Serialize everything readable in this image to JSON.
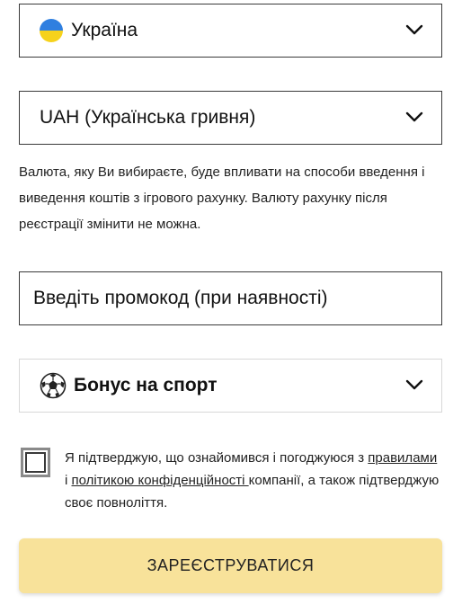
{
  "country": {
    "value": "Україна",
    "icon": "ukraine-flag-icon"
  },
  "currency": {
    "value": "UAH (Українська гривня)"
  },
  "currency_note": "Валюта, яку Ви вибираєте, буде впливати на способи введення і виведення коштів з ігрового рахунку. Валюту рахунку після реєстрації змінити не можна.",
  "promo": {
    "placeholder": "Введіть промокод (при наявності)"
  },
  "bonus": {
    "value": "Бонус на спорт",
    "icon": "soccer-ball-icon"
  },
  "agreement": {
    "text_before": "Я підтверджую, що ознайомився і погоджуюся з ",
    "rules_link": "правилами",
    "text_and": " і ",
    "privacy_link": "політикою конфіденційності ",
    "text_after": "компанії, а також підтверджую своє повноліття."
  },
  "submit_label": "ЗАРЕЄСТРУВАТИСЯ",
  "colors": {
    "submit_bg": "#f8e29a",
    "flag_blue": "#2f7fe0",
    "flag_yellow": "#f6d21c"
  }
}
